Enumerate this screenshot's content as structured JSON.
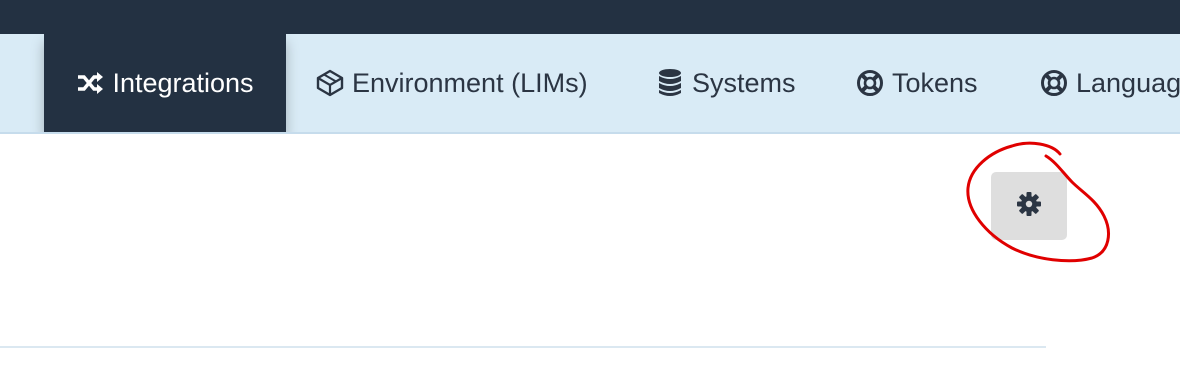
{
  "tabs": [
    {
      "label": "Integrations",
      "icon": "shuffle-icon",
      "active": true
    },
    {
      "label": "Environment (LIMs)",
      "icon": "cube-icon",
      "active": false
    },
    {
      "label": "Systems",
      "icon": "database-icon",
      "active": false
    },
    {
      "label": "Tokens",
      "icon": "lifebuoy-icon",
      "active": false
    },
    {
      "label": "Languag",
      "icon": "lifebuoy-icon",
      "active": false
    }
  ],
  "toolbar": {
    "settings_icon": "gear-icon"
  },
  "colors": {
    "topbar": "#233142",
    "tabstrip": "#d9ebf6",
    "active_tab": "#233142",
    "annotation": "#e00000"
  }
}
